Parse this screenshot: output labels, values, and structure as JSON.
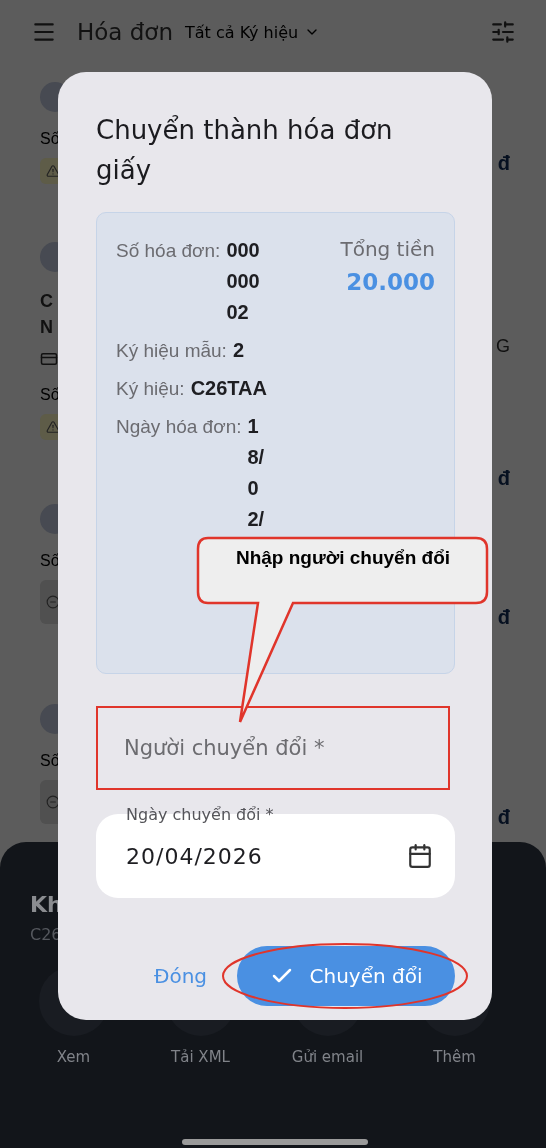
{
  "header": {
    "title": "Hóa đơn",
    "filter": "Tất cả Ký hiệu"
  },
  "background_list": [
    {
      "kind": "warning",
      "card_icon": false,
      "number_label": "Số",
      "amount": "đ"
    },
    {
      "kind": "warning",
      "title_lines": [
        "C",
        "N"
      ],
      "title_right": "G",
      "card_icon": true,
      "number_label": "Số",
      "amount": "đ"
    },
    {
      "kind": "neutral",
      "card_icon": false,
      "number_label": "Số",
      "amount": "đ"
    },
    {
      "kind": "neutral",
      "card_icon": false,
      "number_label": "Số",
      "amount": "đ"
    }
  ],
  "bottom_sheet": {
    "title": "Kh",
    "subtitle": "C26",
    "actions": [
      "Xem",
      "Tải XML",
      "Gửi email",
      "Thêm"
    ]
  },
  "dialog": {
    "title": "Chuyển thành hóa đơn giấy",
    "info": [
      {
        "label": "Số hóa đơn:",
        "value": "00000002"
      },
      {
        "label": "Ký hiệu mẫu:",
        "value": "2"
      },
      {
        "label": "Ký hiệu:",
        "value": "C26TAA"
      },
      {
        "label": "Ngày hóa đơn:",
        "value": "18/02/"
      }
    ],
    "total_label": "Tổng tiền",
    "total_value": "20.000",
    "converter_field": {
      "placeholder": "Người chuyển đổi *"
    },
    "date_field": {
      "label": "Ngày chuyển đổi *",
      "value": "20/04/2026"
    },
    "cancel_button": "Đóng",
    "confirm_button": "Chuyển đổi"
  },
  "annotation": {
    "callout_text": "Nhập người chuyển đổi"
  }
}
